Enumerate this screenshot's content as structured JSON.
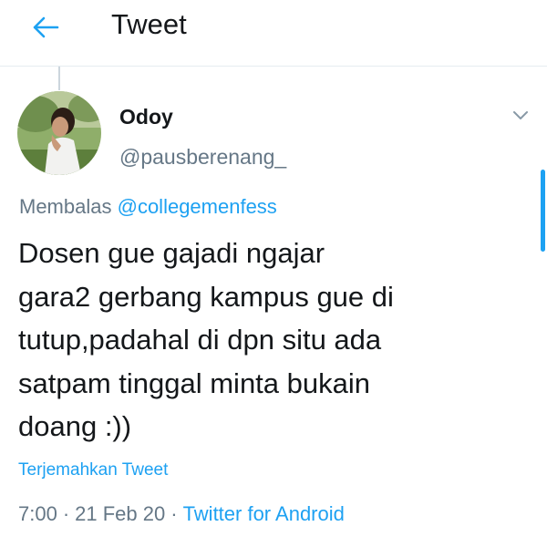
{
  "header": {
    "title": "Tweet",
    "back_icon": "arrow-left-icon"
  },
  "tweet": {
    "display_name": "Odoy",
    "username": "@pausberenang_",
    "reply_prefix": "Membalas",
    "reply_to": "@collegemenfess",
    "text": "Dosen gue gajadi ngajar\ngara2 gerbang kampus gue di\ntutup,padahal di dpn situ ada\nsatpam tinggal minta bukain\ndoang :))",
    "translate_label": "Terjemahkan Tweet",
    "time": "7:00",
    "date": "21 Feb 20",
    "separator": "·",
    "source": "Twitter for Android"
  },
  "colors": {
    "accent": "#1da1f2",
    "secondary_text": "#657786",
    "primary_text": "#14171a",
    "divider": "#e6ecf0"
  }
}
